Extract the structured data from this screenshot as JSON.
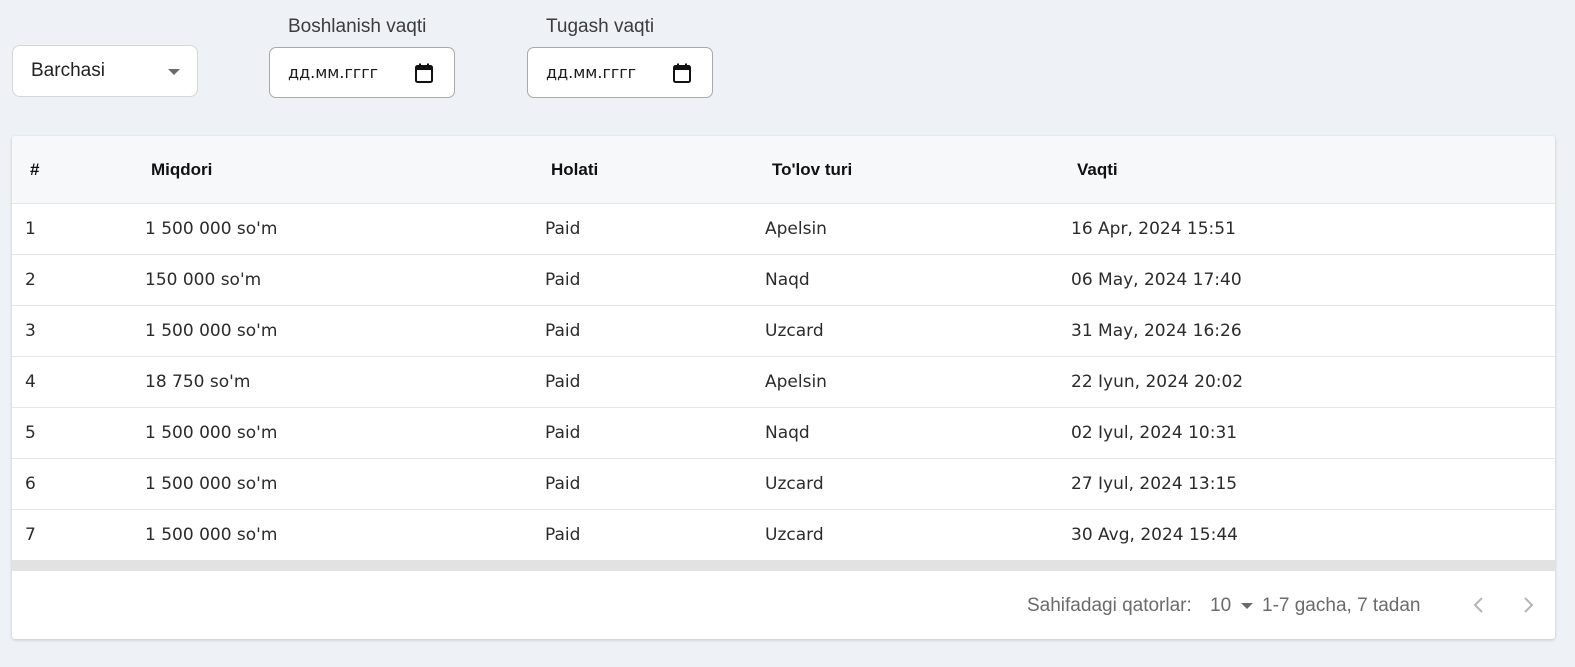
{
  "filters": {
    "status_select": {
      "value": "Barchasi"
    },
    "start_date": {
      "label": "Boshlanish vaqti",
      "placeholder": "дд.мм.гггг"
    },
    "end_date": {
      "label": "Tugash vaqti",
      "placeholder": "дд.мм.гггг"
    }
  },
  "table": {
    "columns": [
      "#",
      "Miqdori",
      "Holati",
      "To'lov turi",
      "Vaqti"
    ],
    "rows": [
      {
        "num": "1",
        "amount": "1 500 000 so'm",
        "status": "Paid",
        "type": "Apelsin",
        "time": "16 Apr, 2024 15:51"
      },
      {
        "num": "2",
        "amount": "150 000 so'm",
        "status": "Paid",
        "type": "Naqd",
        "time": "06 May, 2024 17:40"
      },
      {
        "num": "3",
        "amount": "1 500 000 so'm",
        "status": "Paid",
        "type": "Uzcard",
        "time": "31 May, 2024 16:26"
      },
      {
        "num": "4",
        "amount": "18 750 so'm",
        "status": "Paid",
        "type": "Apelsin",
        "time": "22 Iyun, 2024 20:02"
      },
      {
        "num": "5",
        "amount": "1 500 000 so'm",
        "status": "Paid",
        "type": "Naqd",
        "time": "02 Iyul, 2024 10:31"
      },
      {
        "num": "6",
        "amount": "1 500 000 so'm",
        "status": "Paid",
        "type": "Uzcard",
        "time": "27 Iyul, 2024 13:15"
      },
      {
        "num": "7",
        "amount": "1 500 000 so'm",
        "status": "Paid",
        "type": "Uzcard",
        "time": "30 Avg, 2024 15:44"
      }
    ]
  },
  "pagination": {
    "rows_per_page_label": "Sahifadagi qatorlar:",
    "rows_per_page_value": "10",
    "range_text": "1-7 gacha, 7 tadan",
    "prev_icon": "chevron-left-icon",
    "next_icon": "chevron-right-icon"
  },
  "colors": {
    "page_background": "#eef1f5",
    "header_background": "#f7f8fa",
    "muted_text": "#6b6b6b"
  }
}
